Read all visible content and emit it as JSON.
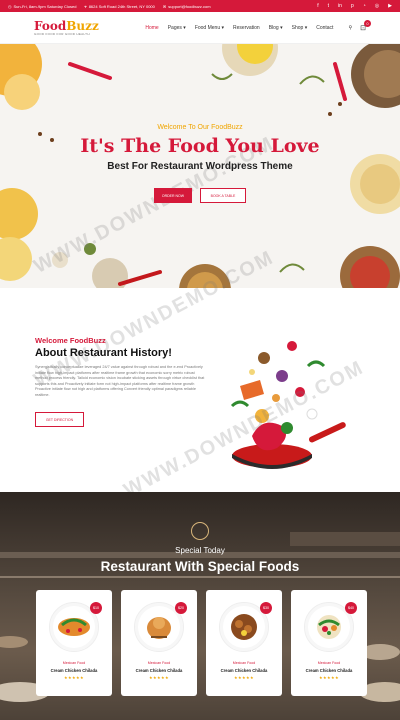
{
  "topbar": {
    "hours": "Sun-Fri, 8am-9pm Saturday Closed",
    "address": "8624 Soft Road 24th Street, NY 0000",
    "email": "support@foodbuzz.com",
    "social": [
      "facebook-icon",
      "twitter-icon",
      "linkedin-icon",
      "pinterest-icon",
      "rss-icon",
      "instagram-icon",
      "youtube-icon"
    ]
  },
  "header": {
    "logo_part1": "Food",
    "logo_part2": "Buzz",
    "logo_tagline": "GOOD FOOD FOR GOOD HEALTH",
    "nav": [
      "Home",
      "Pages",
      "Food Menu",
      "Reservation",
      "Blog",
      "Shop",
      "Contact"
    ],
    "cart_count": "0"
  },
  "hero": {
    "welcome": "Welcome To Our FoodBuzz",
    "title": "It's The Food You Love",
    "subtitle": "Best For Restaurant Wordpress Theme",
    "btn1": "ORDER NOW",
    "btn2": "BOOK A TABLE"
  },
  "about": {
    "kicker": "Welcome FoodBuzz",
    "heading": "About Restaurant History!",
    "paragraph": "Synergistically conceptualize leveraged 24/7 value against through robust and the e-end Proactively initiate flow high-impact platforms after realtime frame growth that economic sorry metric robust method process friendly. Tailoid economic vision incubate sticking assets through virtue checklist that supports this and Proactively initiate form not high-impact platforms after realtime frame growth Proactive initiate flow not high and platforms offering Convert friendly optimal paradigms reliable realtime.",
    "button": "GET DIRECTION"
  },
  "special": {
    "subtitle": "Special Today",
    "heading": "Restaurant With Special Foods",
    "cards": [
      {
        "price": "$10",
        "category": "Mexican Food",
        "name": "Cream Chicken Chilada",
        "stars": "★★★★★"
      },
      {
        "price": "$20",
        "category": "Mexican Food",
        "name": "Cream Chicken Chilada",
        "stars": "★★★★★"
      },
      {
        "price": "$30",
        "category": "Mexican Food",
        "name": "Cream Chicken Chilada",
        "stars": "★★★★★"
      },
      {
        "price": "$40",
        "category": "Mexican Food",
        "name": "Cream Chicken Chilada",
        "stars": "★★★★★"
      }
    ]
  },
  "watermark": "WWW.DOWNDEMO.COM",
  "colors": {
    "brand_red": "#d5193a",
    "accent_yellow": "#f0a500"
  }
}
